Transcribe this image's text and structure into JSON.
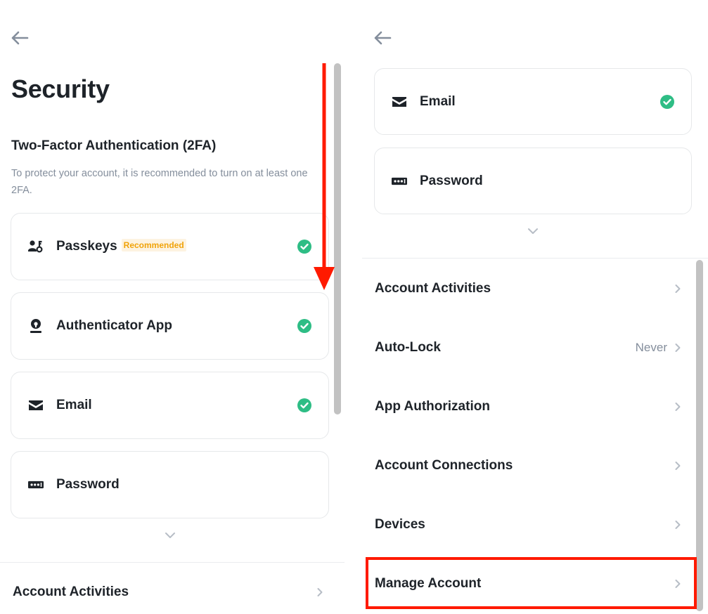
{
  "left_panel": {
    "title": "Security",
    "section_title": "Two-Factor Authentication (2FA)",
    "section_desc": "To protect your account, it is recommended to turn on at least one 2FA.",
    "cards": [
      {
        "label": "Passkeys",
        "badge": "Recommended",
        "icon": "passkey-icon",
        "checked": true
      },
      {
        "label": "Authenticator App",
        "icon": "authenticator-icon",
        "checked": true
      },
      {
        "label": "Email",
        "icon": "mail-icon",
        "checked": true
      },
      {
        "label": "Password",
        "icon": "password-icon",
        "checked": false
      }
    ],
    "rows": [
      {
        "label": "Account Activities"
      }
    ]
  },
  "right_panel": {
    "cards": [
      {
        "label": "Email",
        "icon": "mail-icon",
        "checked": true
      },
      {
        "label": "Password",
        "icon": "password-icon",
        "checked": false
      }
    ],
    "rows": [
      {
        "label": "Account Activities",
        "value": ""
      },
      {
        "label": "Auto-Lock",
        "value": "Never"
      },
      {
        "label": "App Authorization",
        "value": ""
      },
      {
        "label": "Account Connections",
        "value": ""
      },
      {
        "label": "Devices",
        "value": ""
      },
      {
        "label": "Manage Account",
        "value": "",
        "highlighted": true
      }
    ]
  },
  "colors": {
    "text_primary": "#1e2329",
    "text_secondary": "#848e9c",
    "check_green": "#2ebd85",
    "badge_text": "#f0a30a",
    "badge_bg": "#fdf3e1",
    "annotation_red": "#ff1a00"
  }
}
